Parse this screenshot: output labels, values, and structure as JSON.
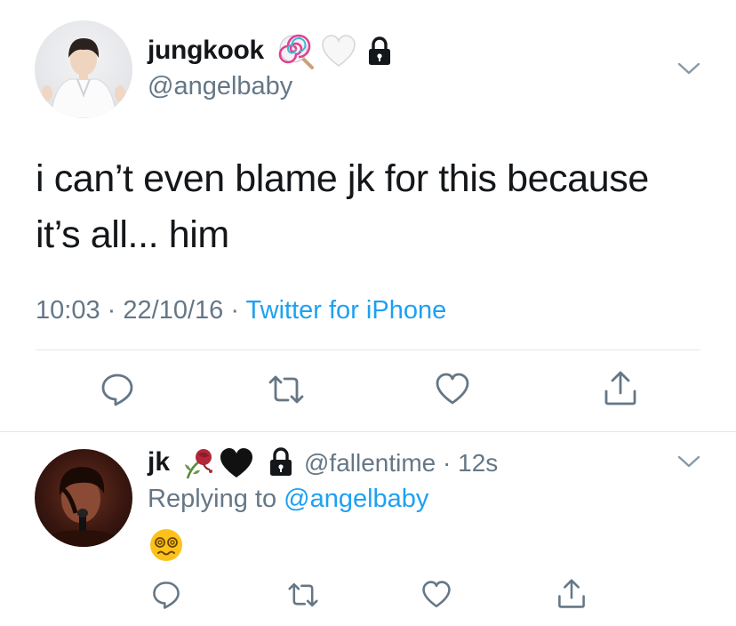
{
  "main_tweet": {
    "display_name": "jungkook",
    "name_emojis": [
      "lollipop-icon",
      "white-heart-icon"
    ],
    "handle": "@angelbaby",
    "text_line1": "i can’t even blame jk for this because",
    "text_line2": "it’s all... him",
    "time": "10:03",
    "separator": "·",
    "date": "22/10/16",
    "source": "Twitter for iPhone"
  },
  "reply_tweet": {
    "display_name": "jk",
    "name_emojis": [
      "wilted-rose-icon",
      "black-heart-icon"
    ],
    "handle": "@fallentime",
    "separator": "·",
    "age": "12s",
    "replying_prefix": "Replying to",
    "replying_to": "@angelbaby",
    "body_emoji": "woozy-dizzy-face-icon"
  },
  "colors": {
    "text": "#14171a",
    "secondary": "#657786",
    "link": "#1da1f2",
    "divider": "#e1e8ed"
  }
}
